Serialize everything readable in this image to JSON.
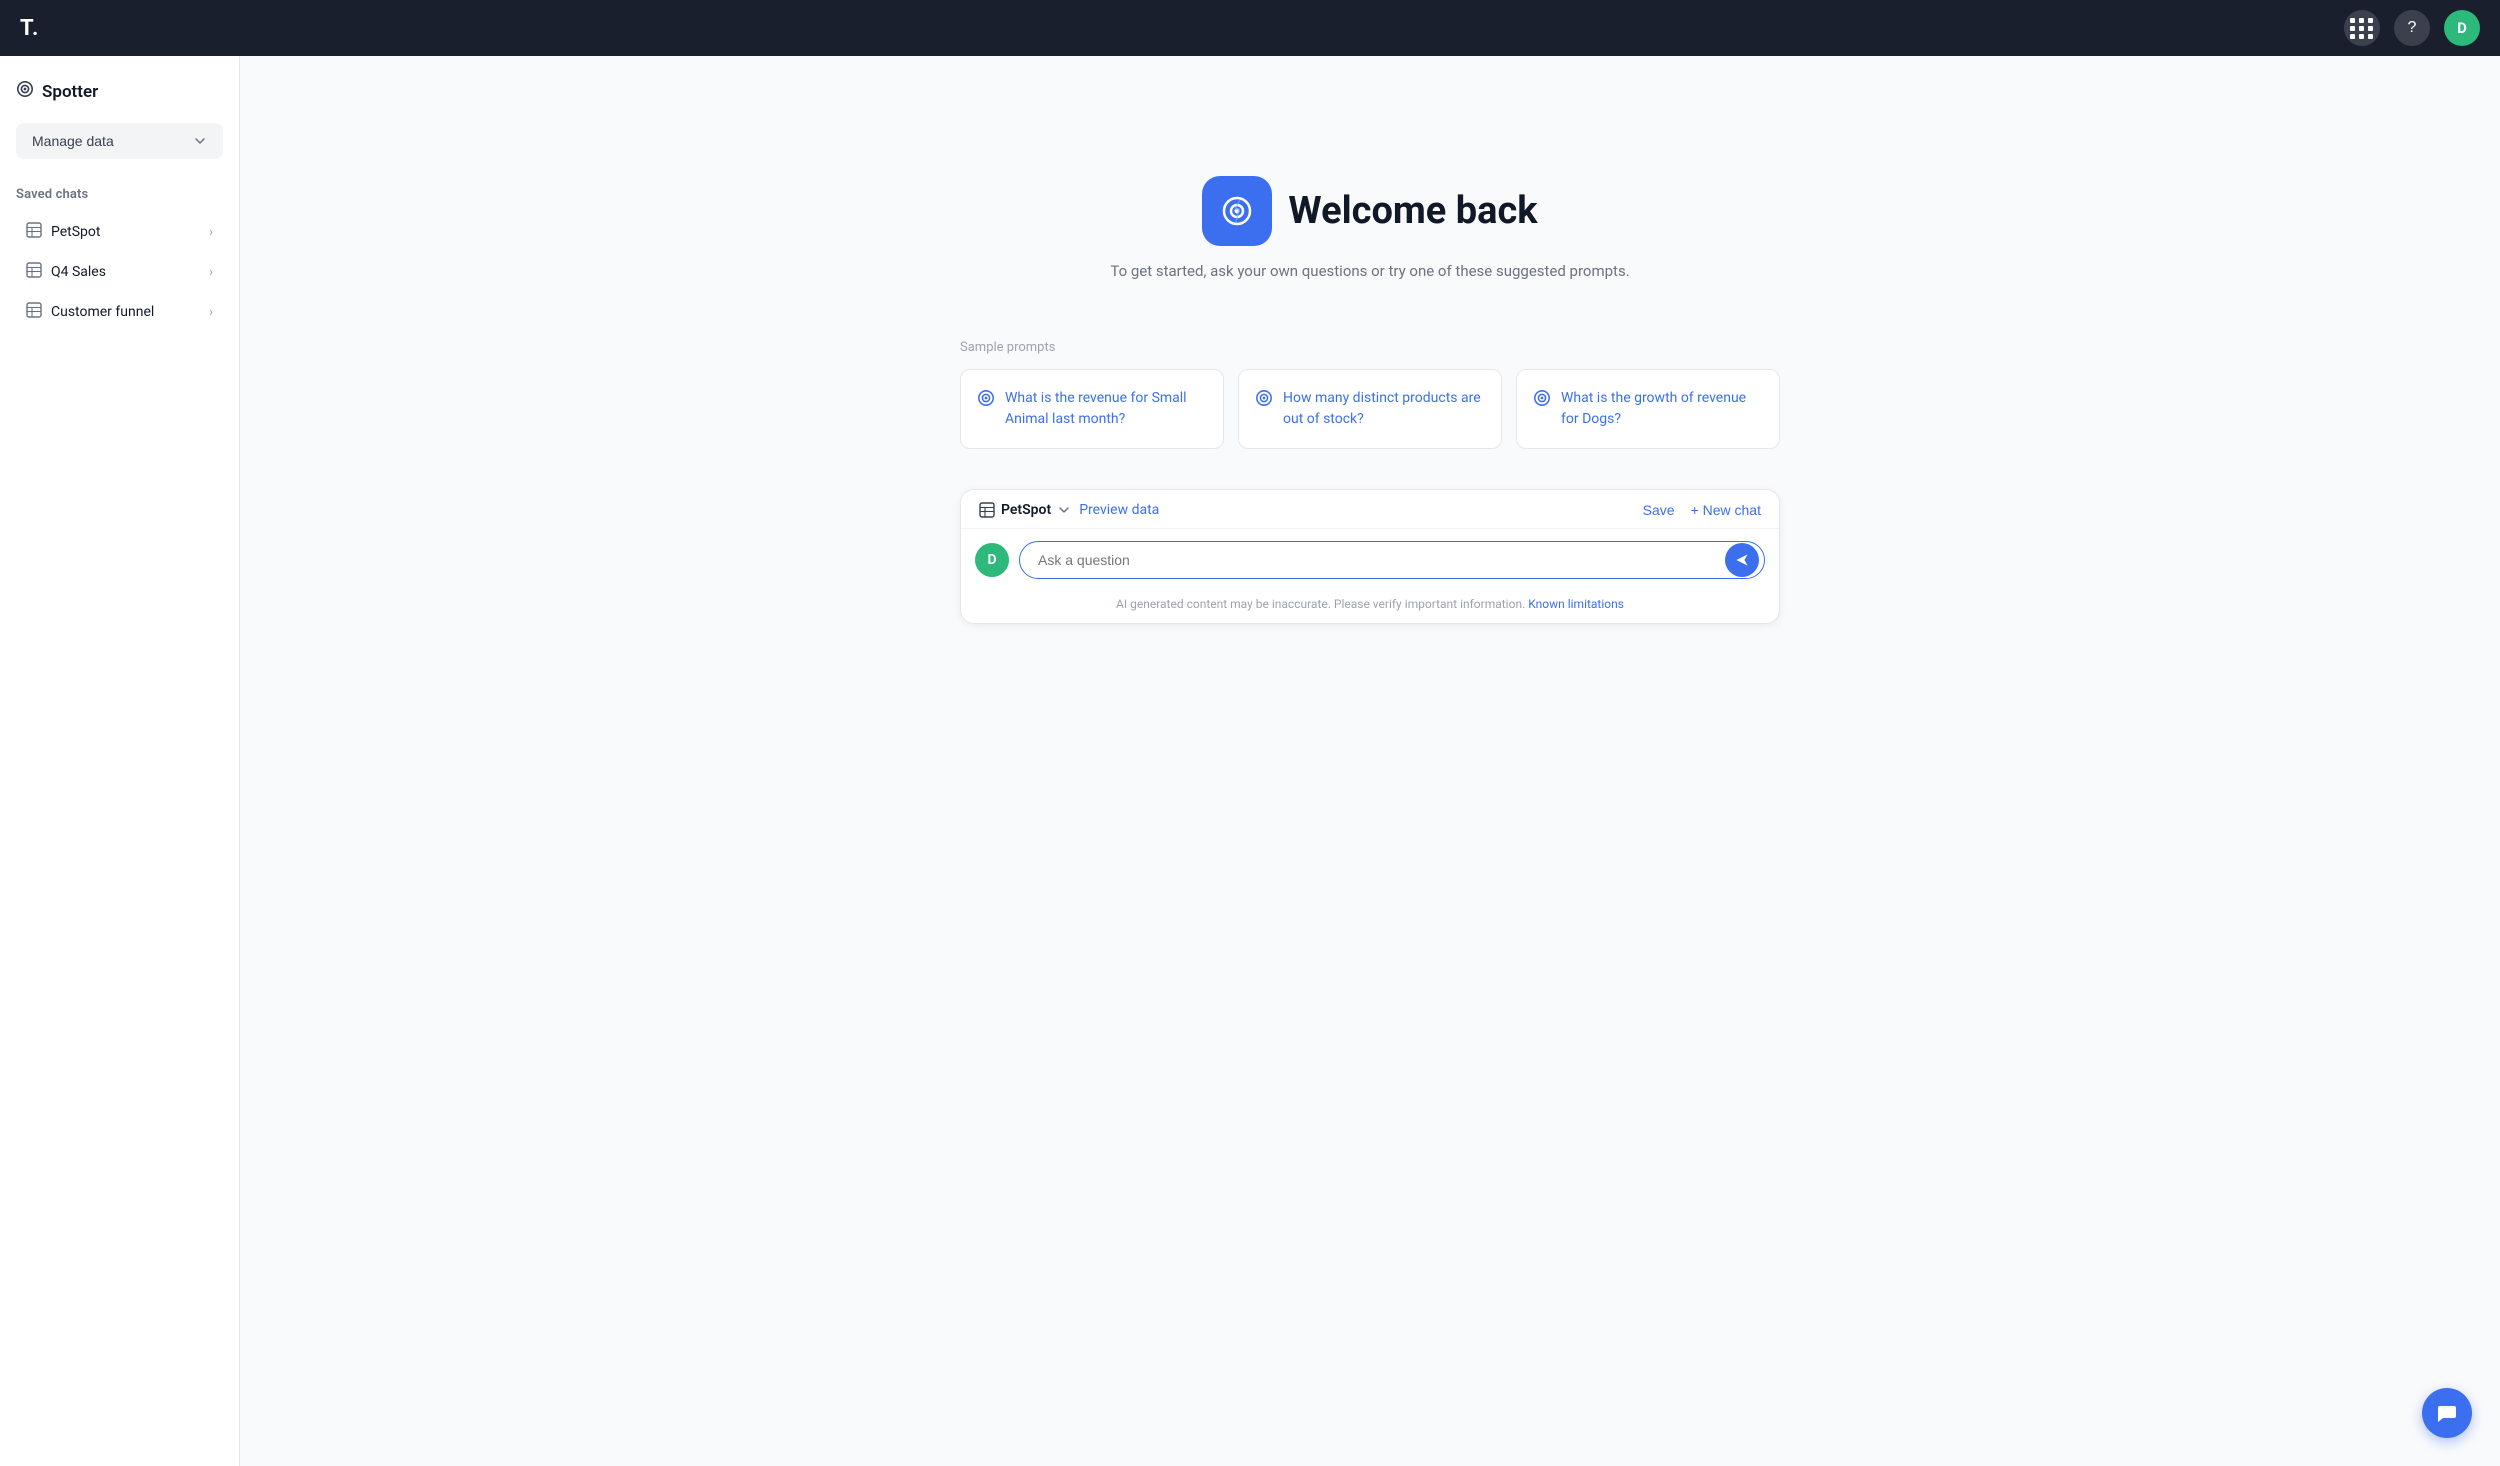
{
  "topnav": {
    "logo": "T.",
    "grid_icon": "grid-icon",
    "help_icon": "help-icon",
    "avatar_label": "D"
  },
  "sidebar": {
    "app_name": "Spotter",
    "manage_data_label": "Manage data",
    "saved_chats_label": "Saved chats",
    "chats": [
      {
        "id": "petspot",
        "label": "PetSpot"
      },
      {
        "id": "q4sales",
        "label": "Q4 Sales"
      },
      {
        "id": "customer-funnel",
        "label": "Customer funnel"
      }
    ]
  },
  "welcome": {
    "title": "Welcome back",
    "subtitle": "To get started, ask your own questions or try one of these suggested prompts."
  },
  "prompts": {
    "section_label": "Sample prompts",
    "items": [
      {
        "text": "What is the revenue for Small Animal last month?"
      },
      {
        "text": "How many distinct products are out of stock?"
      },
      {
        "text": "What is the growth of revenue for Dogs?"
      }
    ]
  },
  "chat_input": {
    "dataset_label": "PetSpot",
    "preview_data_label": "Preview data",
    "save_label": "Save",
    "new_chat_label": "+ New chat",
    "placeholder": "Ask a question",
    "user_avatar": "D",
    "footer_note": "AI generated content may be inaccurate. Please verify important information.",
    "known_limitations_label": "Known limitations"
  }
}
